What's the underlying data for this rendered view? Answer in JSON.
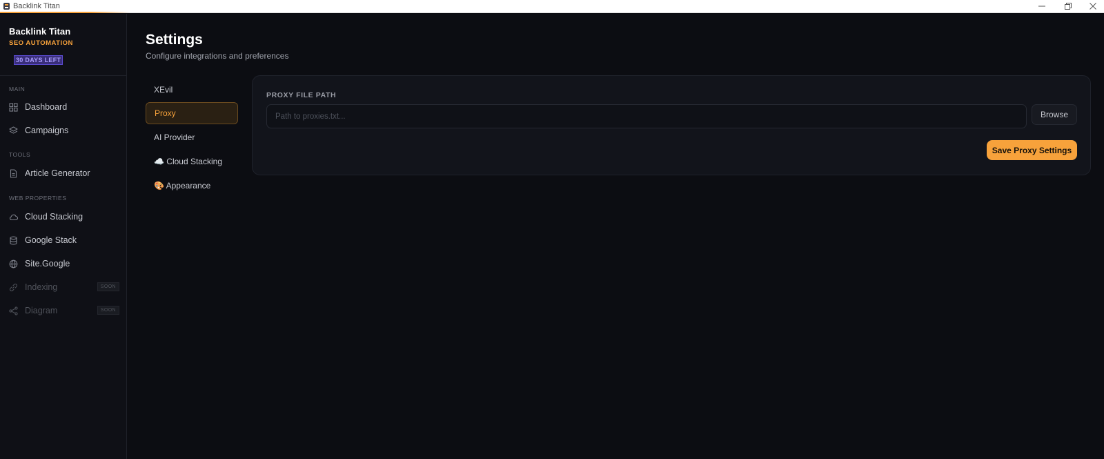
{
  "window": {
    "title": "Backlink Titan",
    "accent": "#f7a23b"
  },
  "sidebar": {
    "brand_name": "Backlink Titan",
    "brand_sub": "SEO AUTOMATION",
    "trial_badge": "30 DAYS LEFT",
    "sections": {
      "main": "MAIN",
      "tools": "TOOLS",
      "web_properties": "WEB PROPERTIES"
    },
    "items": {
      "dashboard": {
        "label": "Dashboard",
        "icon": "grid-icon"
      },
      "campaigns": {
        "label": "Campaigns",
        "icon": "layers-icon"
      },
      "article_generator": {
        "label": "Article Generator",
        "icon": "document-icon"
      },
      "cloud_stacking": {
        "label": "Cloud Stacking",
        "icon": "cloud-icon"
      },
      "google_stack": {
        "label": "Google Stack",
        "icon": "database-icon"
      },
      "site_google": {
        "label": "Site.Google",
        "icon": "globe-icon"
      },
      "indexing": {
        "label": "Indexing",
        "icon": "link-icon",
        "badge": "SOON"
      },
      "diagram": {
        "label": "Diagram",
        "icon": "share-icon",
        "badge": "SOON"
      }
    }
  },
  "header": {
    "title": "Settings",
    "subtitle": "Configure integrations and preferences"
  },
  "settings_tabs": [
    {
      "label": "XEvil",
      "active": false
    },
    {
      "label": "Proxy",
      "active": true
    },
    {
      "label": "AI Provider",
      "active": false
    },
    {
      "label": "☁️ Cloud Stacking",
      "active": false
    },
    {
      "label": "🎨 Appearance",
      "active": false
    }
  ],
  "proxy_panel": {
    "field_label": "PROXY FILE PATH",
    "input_value": "",
    "input_placeholder": "Path to proxies.txt...",
    "browse_label": "Browse",
    "save_label": "Save Proxy Settings"
  }
}
